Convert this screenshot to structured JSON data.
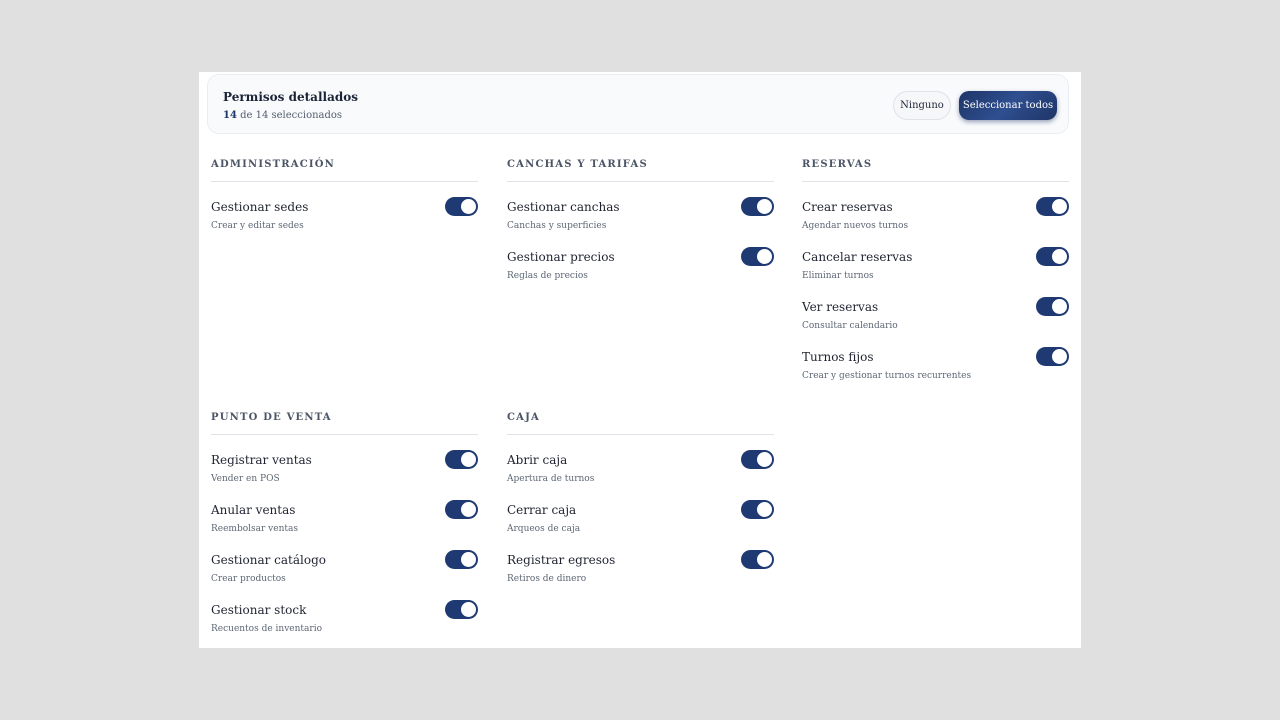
{
  "header": {
    "title": "Permisos detallados",
    "selected_count": "14",
    "selected_suffix": " de 14 seleccionados",
    "none_label": "Ninguno",
    "select_all_label": "Seleccionar todos"
  },
  "colors": {
    "accent": "#1f3a72",
    "background": "#e0e0e0",
    "panel": "#ffffff"
  },
  "sections": [
    {
      "title": "ADMINISTRACIÓN",
      "items": [
        {
          "label": "Gestionar sedes",
          "desc": "Crear y editar sedes",
          "enabled": true
        }
      ]
    },
    {
      "title": "CANCHAS Y TARIFAS",
      "items": [
        {
          "label": "Gestionar canchas",
          "desc": "Canchas y superficies",
          "enabled": true
        },
        {
          "label": "Gestionar precios",
          "desc": "Reglas de precios",
          "enabled": true
        }
      ]
    },
    {
      "title": "RESERVAS",
      "items": [
        {
          "label": "Crear reservas",
          "desc": "Agendar nuevos turnos",
          "enabled": true
        },
        {
          "label": "Cancelar reservas",
          "desc": "Eliminar turnos",
          "enabled": true
        },
        {
          "label": "Ver reservas",
          "desc": "Consultar calendario",
          "enabled": true
        },
        {
          "label": "Turnos fijos",
          "desc": "Crear y gestionar turnos recurrentes",
          "enabled": true
        }
      ]
    },
    {
      "title": "PUNTO DE VENTA",
      "items": [
        {
          "label": "Registrar ventas",
          "desc": "Vender en POS",
          "enabled": true
        },
        {
          "label": "Anular ventas",
          "desc": "Reembolsar ventas",
          "enabled": true
        },
        {
          "label": "Gestionar catálogo",
          "desc": "Crear productos",
          "enabled": true
        },
        {
          "label": "Gestionar stock",
          "desc": "Recuentos de inventario",
          "enabled": true
        }
      ]
    },
    {
      "title": "CAJA",
      "items": [
        {
          "label": "Abrir caja",
          "desc": "Apertura de turnos",
          "enabled": true
        },
        {
          "label": "Cerrar caja",
          "desc": "Arqueos de caja",
          "enabled": true
        },
        {
          "label": "Registrar egresos",
          "desc": "Retiros de dinero",
          "enabled": true
        }
      ]
    }
  ]
}
